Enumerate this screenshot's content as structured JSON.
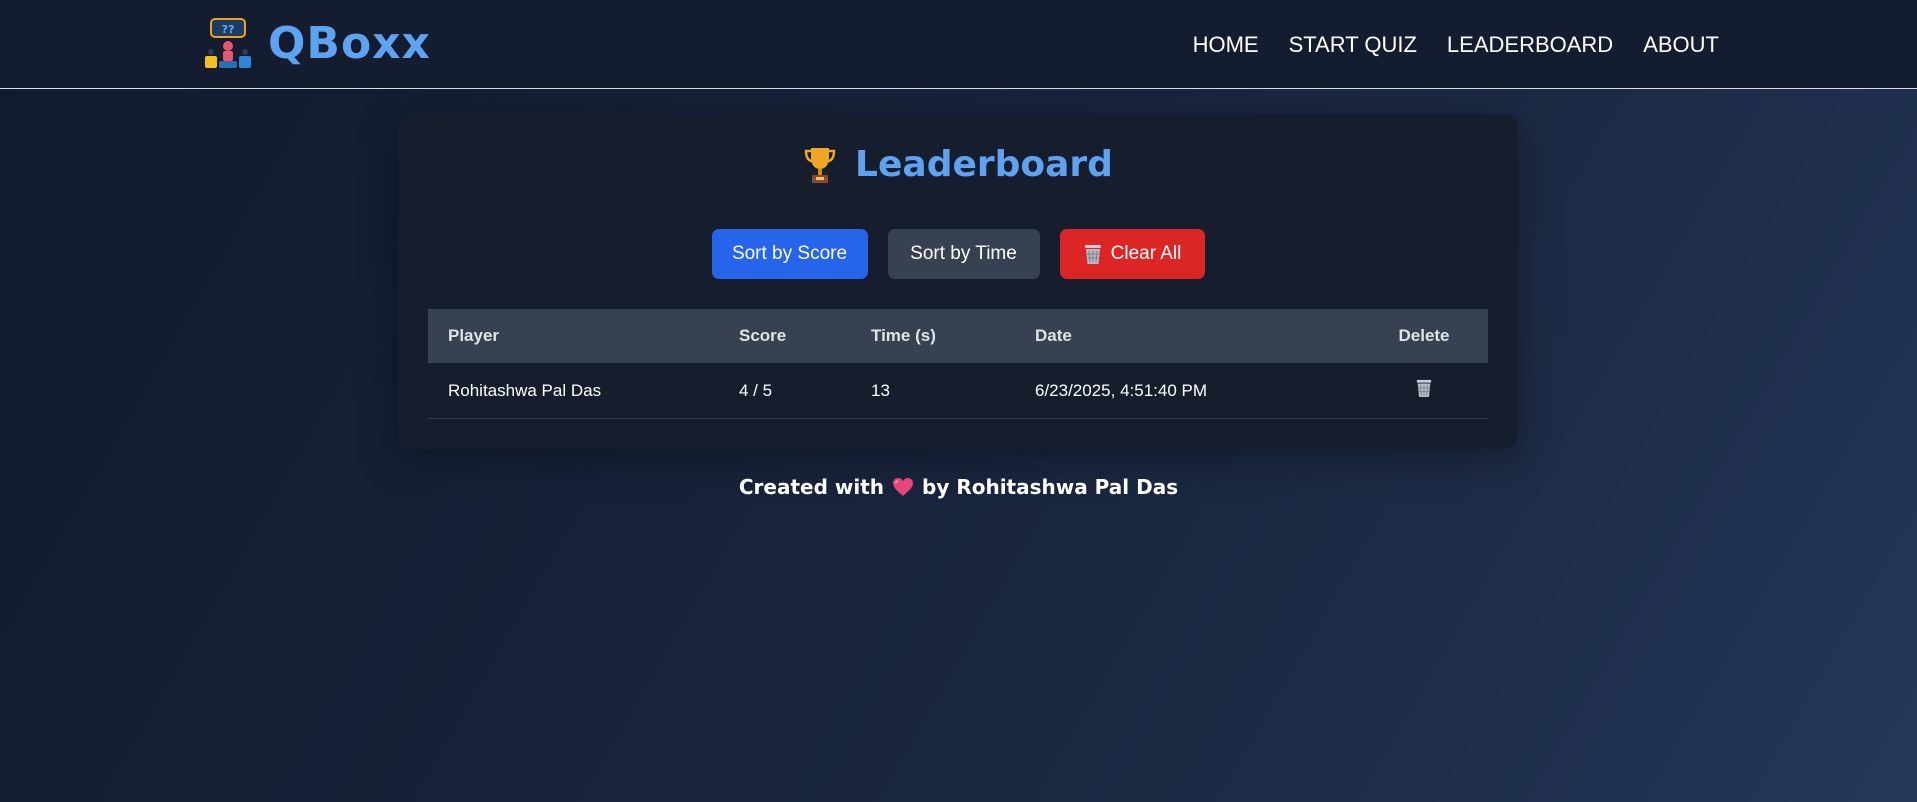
{
  "brand": {
    "name": "QBoxx"
  },
  "nav": {
    "items": [
      "HOME",
      "START QUIZ",
      "LEADERBOARD",
      "ABOUT"
    ]
  },
  "leaderboard": {
    "title": "Leaderboard",
    "title_icon": "trophy-icon",
    "buttons": {
      "sort_score": "Sort by Score",
      "sort_time": "Sort by Time",
      "clear_all": "Clear All"
    },
    "columns": [
      "Player",
      "Score",
      "Time (s)",
      "Date",
      "Delete"
    ],
    "rows": [
      {
        "player": "Rohitashwa Pal Das",
        "score": "4 / 5",
        "time": "13",
        "date": "6/23/2025, 4:51:40 PM"
      }
    ]
  },
  "footer": {
    "prefix": "Created with",
    "suffix": "by Rohitashwa Pal Das",
    "icon": "heart-icon"
  },
  "colors": {
    "accent": "#5ea2f2",
    "primary_button": "#2564eb",
    "secondary_button": "#374152",
    "danger_button": "#dc2626"
  }
}
